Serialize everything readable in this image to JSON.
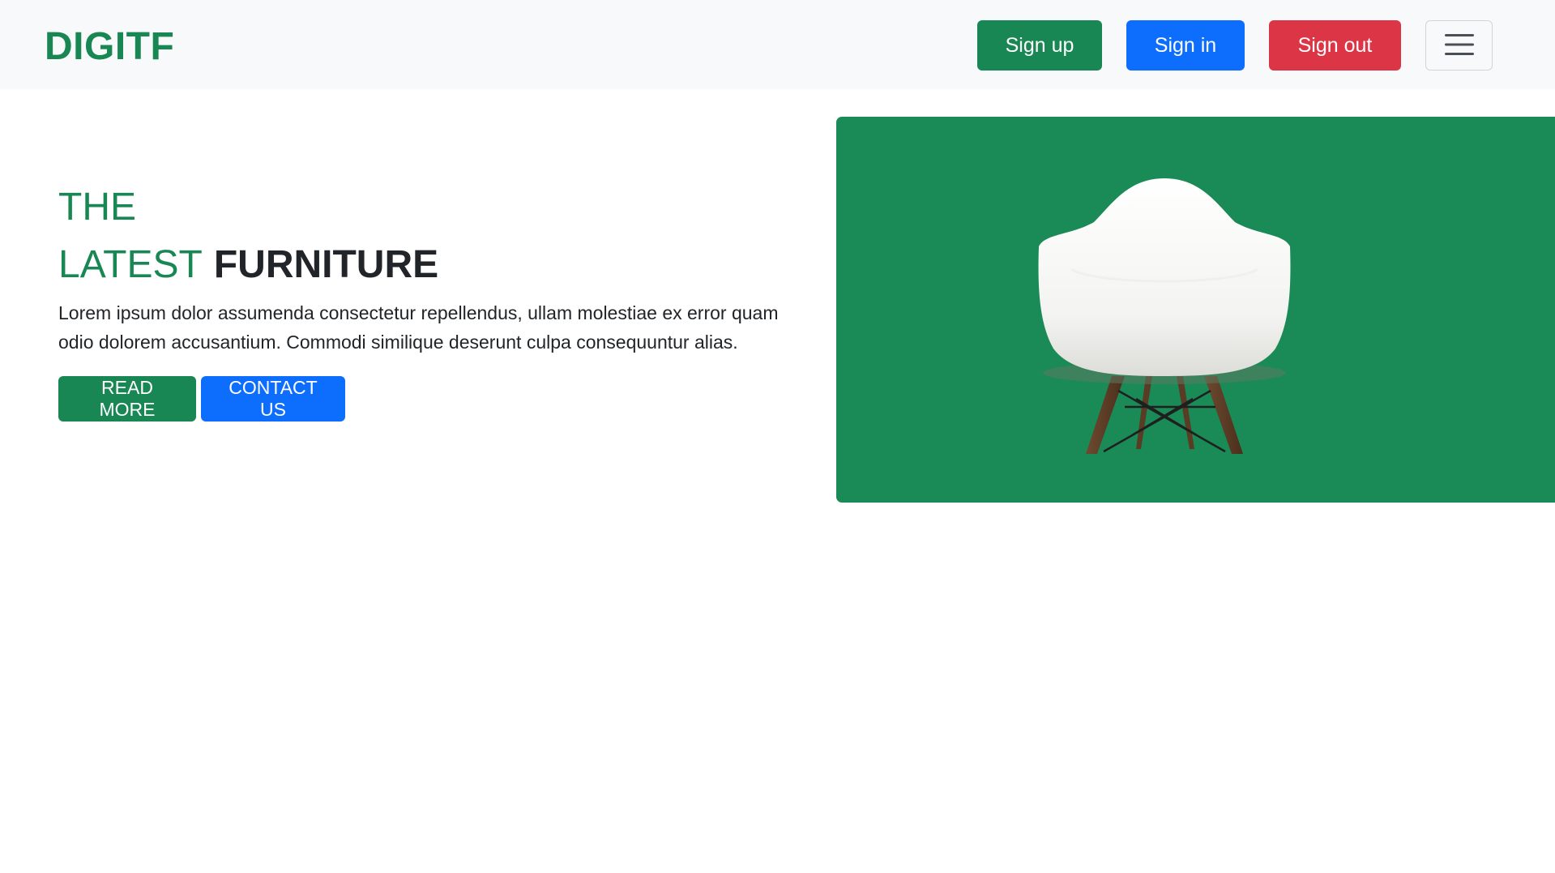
{
  "brand": {
    "name": "DIGITF",
    "color": "#198754"
  },
  "nav": {
    "signup_label": "Sign up",
    "signin_label": "Sign in",
    "signout_label": "Sign out",
    "menu_icon": "hamburger-menu-icon"
  },
  "hero": {
    "title_line1": "THE",
    "title_line2_accent": "LATEST",
    "title_line2_strong": "FURNITURE",
    "description": "Lorem ipsum dolor assumenda consectetur repellendus, ullam molestiae ex error quam odio dolorem accusantium. Commodi similique deserunt culpa consequuntur alias.",
    "read_more_label": "READ MORE",
    "contact_label": "CONTACT US",
    "image_icon": "chair-image",
    "panel_color": "#1a8a57"
  },
  "colors": {
    "success": "#198754",
    "primary": "#0d6efd",
    "danger": "#dc3545",
    "navbar_bg": "#f8f9fa"
  }
}
